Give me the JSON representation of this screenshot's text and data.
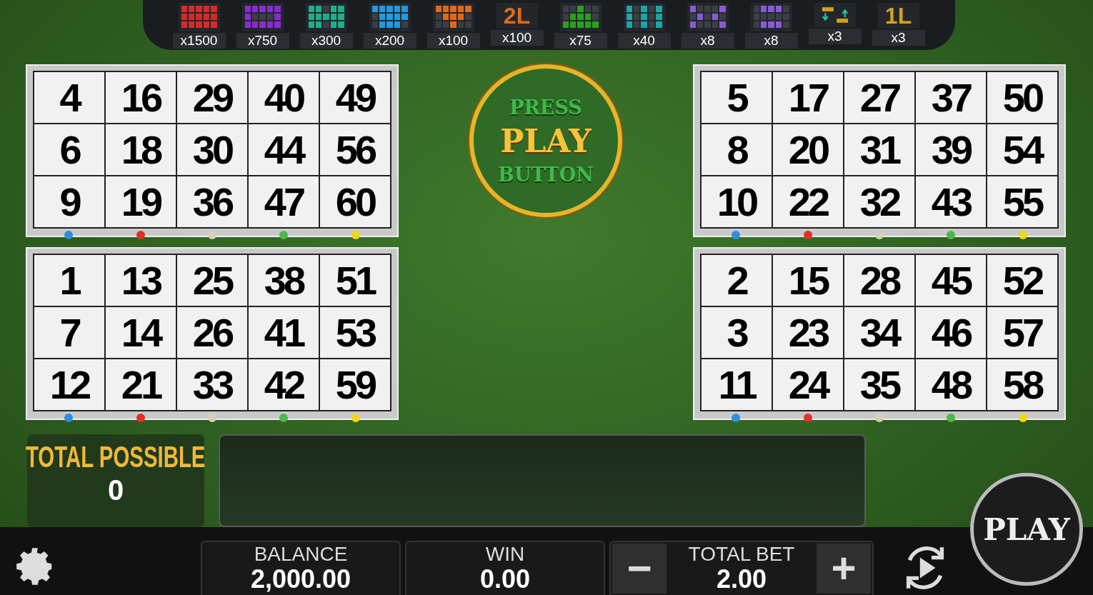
{
  "paytable": [
    {
      "kind": "grid",
      "lit": [
        [
          true,
          true,
          true,
          true,
          true
        ],
        [
          true,
          true,
          true,
          true,
          true
        ],
        [
          true,
          true,
          true,
          true,
          true
        ]
      ],
      "color": "#d42a2a",
      "multiplier": "x1500"
    },
    {
      "kind": "grid",
      "lit": [
        [
          true,
          true,
          true,
          true,
          true
        ],
        [
          true,
          false,
          false,
          false,
          true
        ],
        [
          true,
          true,
          true,
          true,
          true
        ]
      ],
      "color": "#8a2ad4",
      "multiplier": "x750"
    },
    {
      "kind": "grid",
      "lit": [
        [
          true,
          true,
          false,
          true,
          true
        ],
        [
          true,
          true,
          true,
          true,
          true
        ],
        [
          true,
          true,
          false,
          true,
          true
        ]
      ],
      "color": "#1fae8a",
      "multiplier": "x300"
    },
    {
      "kind": "grid",
      "lit": [
        [
          true,
          true,
          true,
          true,
          true
        ],
        [
          false,
          true,
          true,
          true,
          true
        ],
        [
          false,
          true,
          true,
          true,
          false
        ]
      ],
      "color": "#1f9be0",
      "multiplier": "x200"
    },
    {
      "kind": "grid",
      "lit": [
        [
          true,
          true,
          true,
          true,
          true
        ],
        [
          false,
          true,
          true,
          true,
          false
        ],
        [
          false,
          false,
          true,
          false,
          false
        ]
      ],
      "color": "#e06a1a",
      "multiplier": "x100"
    },
    {
      "kind": "text",
      "label": "2L",
      "color": "#e06a1a",
      "multiplier": "x100"
    },
    {
      "kind": "grid",
      "lit": [
        [
          false,
          false,
          true,
          false,
          false
        ],
        [
          false,
          true,
          true,
          true,
          false
        ],
        [
          true,
          true,
          true,
          true,
          true
        ]
      ],
      "color": "#2aa11a",
      "multiplier": "x75"
    },
    {
      "kind": "grid",
      "lit": [
        [
          true,
          false,
          true,
          false,
          true
        ],
        [
          true,
          false,
          true,
          false,
          true
        ],
        [
          true,
          false,
          true,
          false,
          true
        ]
      ],
      "color": "#1aa6a6",
      "multiplier": "x40"
    },
    {
      "kind": "grid",
      "lit": [
        [
          true,
          false,
          false,
          false,
          true
        ],
        [
          false,
          true,
          false,
          true,
          false
        ],
        [
          true,
          false,
          false,
          false,
          true
        ]
      ],
      "color": "#8a5ad4",
      "multiplier": "x8"
    },
    {
      "kind": "grid",
      "lit": [
        [
          false,
          true,
          true,
          true,
          false
        ],
        [
          false,
          false,
          false,
          false,
          false
        ],
        [
          false,
          true,
          true,
          true,
          false
        ]
      ],
      "color": "#8a5ad4",
      "multiplier": "x8"
    },
    {
      "kind": "arrows",
      "color": "#d4a21a",
      "multiplier": "x3"
    },
    {
      "kind": "text",
      "label": "1L",
      "color": "#d4a21a",
      "multiplier": "x3"
    }
  ],
  "column_markers": [
    {
      "color": "#2e8fe0"
    },
    {
      "color": "#e0302a"
    },
    {
      "color": "#d8cfb8"
    },
    {
      "color": "#4cb84c"
    },
    {
      "color": "#f0d81a"
    }
  ],
  "cards": [
    {
      "rows": [
        [
          "4",
          "16",
          "29",
          "40",
          "49"
        ],
        [
          "6",
          "18",
          "30",
          "44",
          "56"
        ],
        [
          "9",
          "19",
          "36",
          "47",
          "60"
        ]
      ]
    },
    {
      "rows": [
        [
          "5",
          "17",
          "27",
          "37",
          "50"
        ],
        [
          "8",
          "20",
          "31",
          "39",
          "54"
        ],
        [
          "10",
          "22",
          "32",
          "43",
          "55"
        ]
      ]
    },
    {
      "rows": [
        [
          "1",
          "13",
          "25",
          "38",
          "51"
        ],
        [
          "7",
          "14",
          "26",
          "41",
          "53"
        ],
        [
          "12",
          "21",
          "33",
          "42",
          "59"
        ]
      ]
    },
    {
      "rows": [
        [
          "2",
          "15",
          "28",
          "45",
          "52"
        ],
        [
          "3",
          "23",
          "34",
          "46",
          "57"
        ],
        [
          "11",
          "24",
          "35",
          "48",
          "58"
        ]
      ]
    }
  ],
  "prompt": {
    "line_1": "PRESS",
    "line_2": "PLAY",
    "line_3": "BUTTON"
  },
  "total_possible": {
    "label": "TOTAL POSSIBLE",
    "value": "0"
  },
  "play_button": "PLAY",
  "bottom_bar": {
    "balance_label": "BALANCE",
    "balance": "2,000.00",
    "win_label": "WIN",
    "win": "0.00",
    "bet_label": "TOTAL BET",
    "bet": "2.00",
    "minus": "−",
    "plus": "+"
  }
}
